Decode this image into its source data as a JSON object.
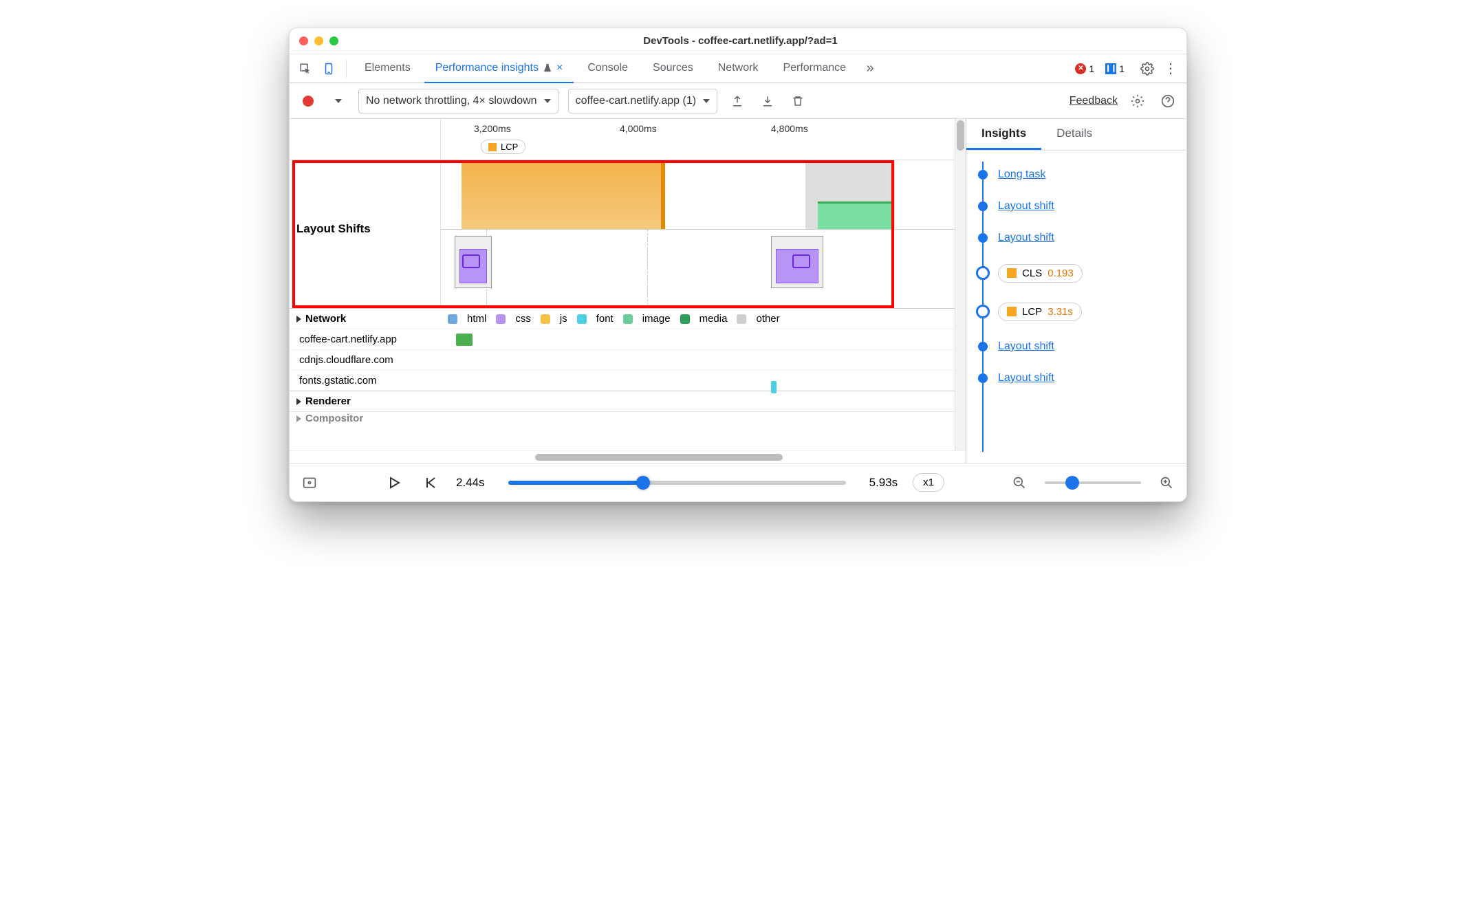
{
  "window": {
    "title": "DevTools - coffee-cart.netlify.app/?ad=1"
  },
  "tabs": {
    "elements": "Elements",
    "perf_insights": "Performance insights",
    "console": "Console",
    "sources": "Sources",
    "network": "Network",
    "performance": "Performance",
    "errors_count": "1",
    "issues_count": "1"
  },
  "toolbar": {
    "throttle": "No network throttling, 4× slowdown",
    "recording": "coffee-cart.netlify.app (1)",
    "feedback": "Feedback"
  },
  "timeline": {
    "ticks": [
      "3,200ms",
      "4,000ms",
      "4,800ms"
    ],
    "lcp_chip": "LCP",
    "layout_shifts_label": "Layout Shifts"
  },
  "network": {
    "header": "Network",
    "legend": {
      "html": "html",
      "css": "css",
      "js": "js",
      "font": "font",
      "image": "image",
      "media": "media",
      "other": "other"
    },
    "domains": [
      "coffee-cart.netlify.app",
      "cdnjs.cloudflare.com",
      "fonts.gstatic.com"
    ],
    "renderer": "Renderer",
    "compositor": "Compositor"
  },
  "insights": {
    "tabs": {
      "insights": "Insights",
      "details": "Details"
    },
    "items": [
      {
        "type": "link",
        "label": "Long task"
      },
      {
        "type": "link",
        "label": "Layout shift"
      },
      {
        "type": "link",
        "label": "Layout shift"
      },
      {
        "type": "chip",
        "metric": "CLS",
        "value": "0.193",
        "color": "#f6a623"
      },
      {
        "type": "chip",
        "metric": "LCP",
        "value": "3.31s",
        "color": "#f6a623"
      },
      {
        "type": "link",
        "label": "Layout shift"
      },
      {
        "type": "link",
        "label": "Layout shift"
      }
    ]
  },
  "footer": {
    "start": "2.44s",
    "end": "5.93s",
    "speed": "x1"
  },
  "colors": {
    "html": "#6fa8dc",
    "css": "#b794f6",
    "js": "#f6c244",
    "font": "#4dd0e1",
    "image": "#6ece9a",
    "media": "#2e9c5b",
    "other": "#cfcfcf"
  }
}
